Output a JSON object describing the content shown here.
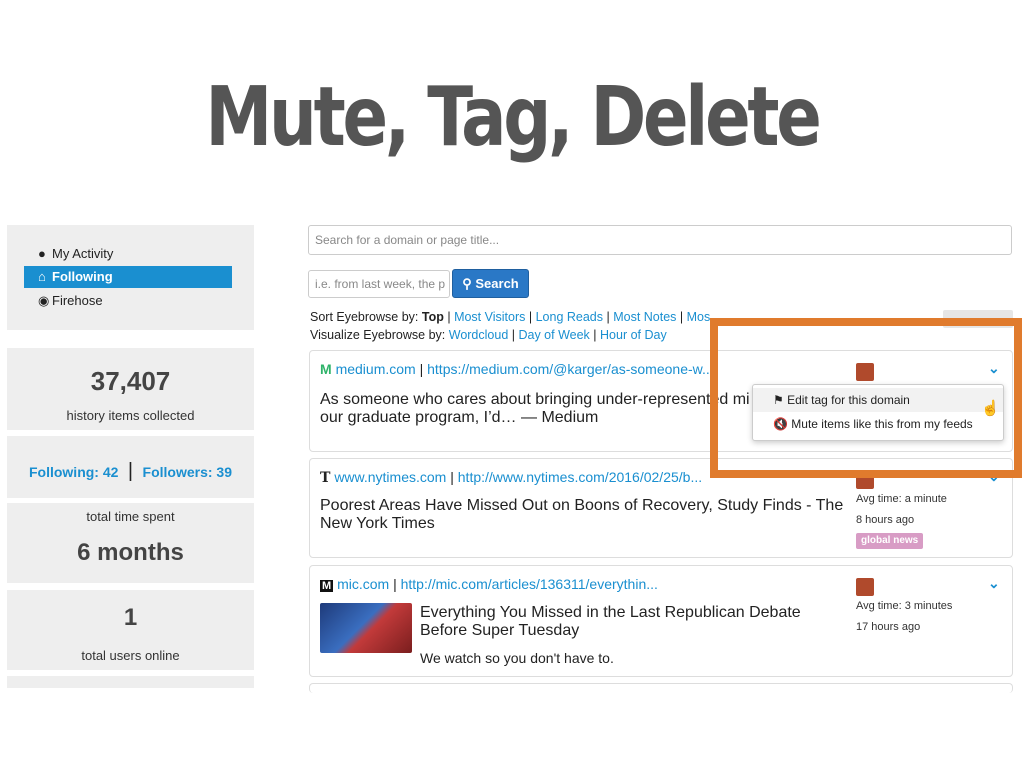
{
  "slide": {
    "title": "Mute, Tag, Delete"
  },
  "sidebar": {
    "nav": [
      {
        "label": "My Activity",
        "icon": "user-icon",
        "active": false
      },
      {
        "label": "Following",
        "icon": "home-icon",
        "active": true
      },
      {
        "label": "Firehose",
        "icon": "globe-icon",
        "active": false
      }
    ],
    "history_count": "37,407",
    "history_label": "history items collected",
    "following_label": "Following: 42",
    "followers_label": "Followers: 39",
    "time_label": "total time spent",
    "time_value": "6 months",
    "online_count": "1",
    "online_label": "total users online"
  },
  "search": {
    "placeholder": "Search for a domain or page title...",
    "date_placeholder": "i.e. from last week, the p",
    "button_label": "Search"
  },
  "sort": {
    "prefix": "Sort Eyebrowse by:",
    "top": "Top",
    "most_visitors": "Most Visitors",
    "long_reads": "Long Reads",
    "most_notes": "Most Notes",
    "most_partial": "Mos"
  },
  "visualize": {
    "prefix": "Visualize Eyebrowse by:",
    "wordcloud": "Wordcloud",
    "day_of_week": "Day of Week",
    "hour_of_day": "Hour of Day"
  },
  "feed": [
    {
      "domain": "medium.com",
      "url": "https://medium.com/@karger/as-someone-w...",
      "title_line1": "As someone who cares about bringing under-represented mi",
      "title_line2": "our graduate program, I’d… — Medium"
    },
    {
      "domain": "www.nytimes.com",
      "url": "http://www.nytimes.com/2016/02/25/b...",
      "title_line1": "Poorest Areas Have Missed Out on Boons of Recovery, Study Finds - The",
      "title_line2": "New York Times",
      "avg_time": "Avg time: a minute",
      "ago": "8 hours ago",
      "tag": "global news"
    },
    {
      "domain": "mic.com",
      "url": "http://mic.com/articles/136311/everythin...",
      "title_line1": "Everything You Missed in the Last Republican Debate",
      "title_line2": "Before Super Tuesday",
      "description": "We watch so you don't have to.",
      "avg_time": "Avg time: 3 minutes",
      "ago": "17 hours ago"
    }
  ],
  "dropdown": {
    "edit_tag": "Edit tag for this domain",
    "mute": "Mute items like this from my feeds"
  },
  "colors": {
    "link": "#1a8fd0",
    "highlight": "#e07b2d",
    "tag": "#d89cc5",
    "active_nav": "#1a8fd0"
  }
}
